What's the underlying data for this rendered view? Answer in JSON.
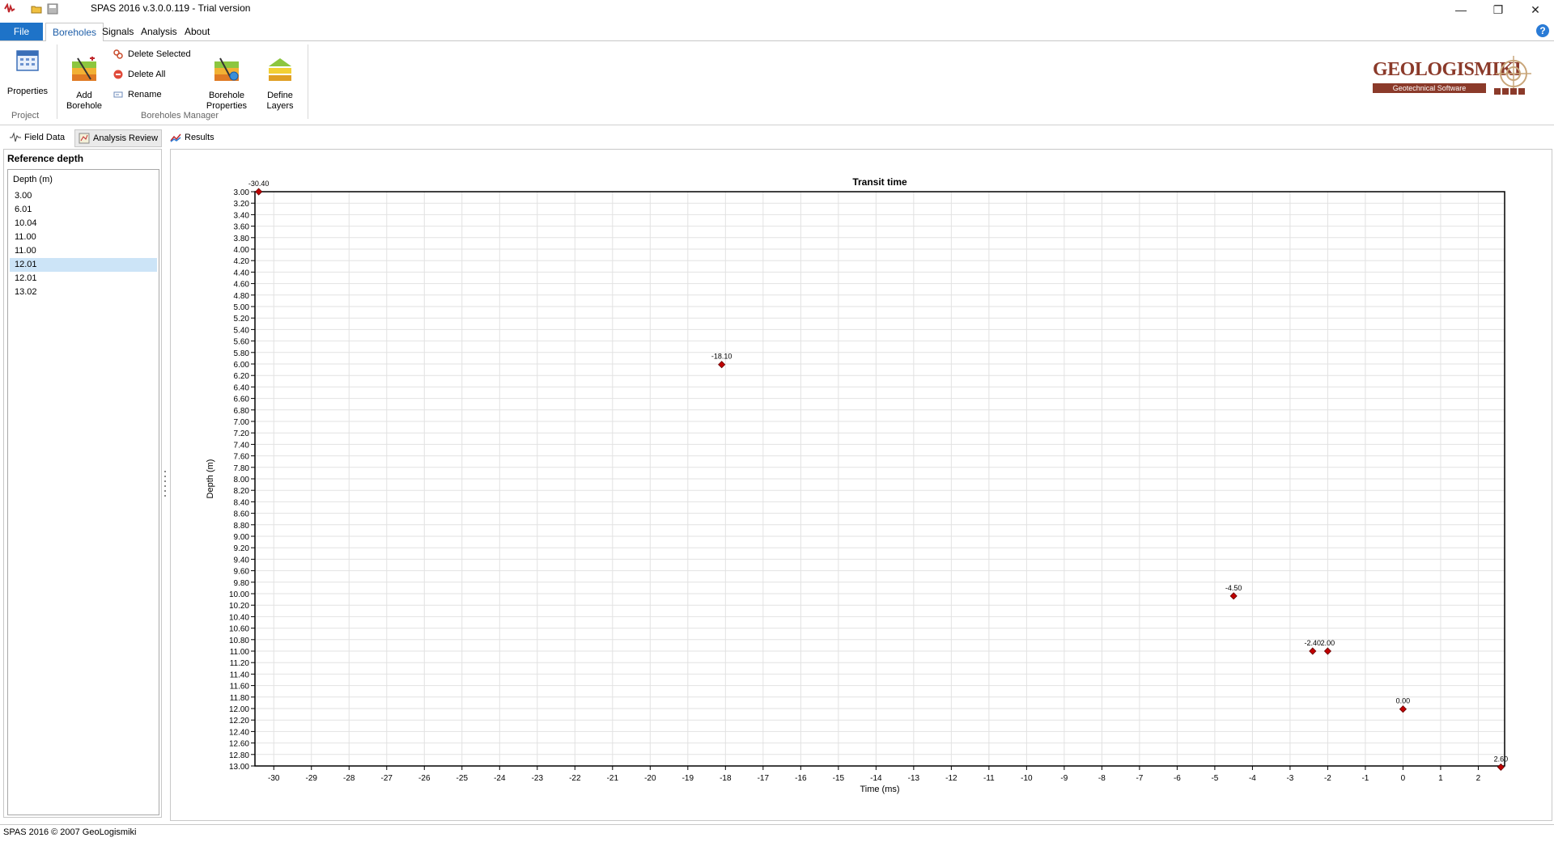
{
  "window": {
    "title": "SPAS 2016 v.3.0.0.119 - Trial version"
  },
  "menu": {
    "file": "File",
    "tabs": [
      "Boreholes",
      "Signals",
      "Analysis",
      "About"
    ],
    "active_tab": "Boreholes"
  },
  "ribbon": {
    "project_group": {
      "label": "Project",
      "properties": "Properties"
    },
    "boreholes_group": {
      "label": "Boreholes Manager",
      "add_borehole": "Add\nBorehole",
      "delete_selected": "Delete Selected",
      "delete_all": "Delete All",
      "rename": "Rename",
      "borehole_properties": "Borehole\nProperties",
      "define_layers": "Define\nLayers"
    },
    "logo": {
      "name": "GEOLOGISMIKI",
      "tagline": "Geotechnical Software"
    }
  },
  "doc_tabs": [
    "Field Data",
    "Analysis Review",
    "Results"
  ],
  "active_doc_tab": "Analysis Review",
  "left_panel": {
    "title": "Reference depth",
    "column_header": "Depth (m)",
    "rows": [
      "3.00",
      "6.01",
      "10.04",
      "11.00",
      "11.00",
      "12.01",
      "12.01",
      "13.02"
    ],
    "selected_index": 5
  },
  "chart_data": {
    "type": "scatter",
    "title": "Transit time",
    "xlabel": "Time (ms)",
    "ylabel": "Depth (m)",
    "xlim": [
      -30.5,
      2.7
    ],
    "ylim": [
      3.0,
      13.0
    ],
    "y_inverted": true,
    "grid": true,
    "x_ticks": [
      -30,
      -29,
      -28,
      -27,
      -26,
      -25,
      -24,
      -23,
      -22,
      -21,
      -20,
      -19,
      -18,
      -17,
      -16,
      -15,
      -14,
      -13,
      -12,
      -11,
      -10,
      -9,
      -8,
      -7,
      -6,
      -5,
      -4,
      -3,
      -2,
      -1,
      0,
      1,
      2
    ],
    "y_ticks": [
      "3.00",
      "3.20",
      "3.40",
      "3.60",
      "3.80",
      "4.00",
      "4.20",
      "4.40",
      "4.60",
      "4.80",
      "5.00",
      "5.20",
      "5.40",
      "5.60",
      "5.80",
      "6.00",
      "6.20",
      "6.40",
      "6.60",
      "6.80",
      "7.00",
      "7.20",
      "7.40",
      "7.60",
      "7.80",
      "8.00",
      "8.20",
      "8.40",
      "8.60",
      "8.80",
      "9.00",
      "9.20",
      "9.40",
      "9.60",
      "9.80",
      "10.00",
      "10.20",
      "10.40",
      "10.60",
      "10.80",
      "11.00",
      "11.20",
      "11.40",
      "11.60",
      "11.80",
      "12.00",
      "12.20",
      "12.40",
      "12.60",
      "12.80",
      "13.00"
    ],
    "marker_color": "#c00000",
    "points": [
      {
        "x": -30.4,
        "y": 3.0,
        "label": "-30.40"
      },
      {
        "x": -18.1,
        "y": 6.01,
        "label": "-18.10"
      },
      {
        "x": -4.5,
        "y": 10.04,
        "label": "-4.50"
      },
      {
        "x": -2.4,
        "y": 11.0,
        "label": "-2.40"
      },
      {
        "x": -2.0,
        "y": 11.0,
        "label": "2.00"
      },
      {
        "x": 0.0,
        "y": 12.01,
        "label": "0.00"
      },
      {
        "x": 2.6,
        "y": 13.02,
        "label": "2.60"
      }
    ]
  },
  "status_bar": "SPAS 2016 © 2007 GeoLogismiki",
  "colors": {
    "accent": "#1e73c8",
    "selection": "#cce4f7",
    "marker": "#c00000"
  }
}
